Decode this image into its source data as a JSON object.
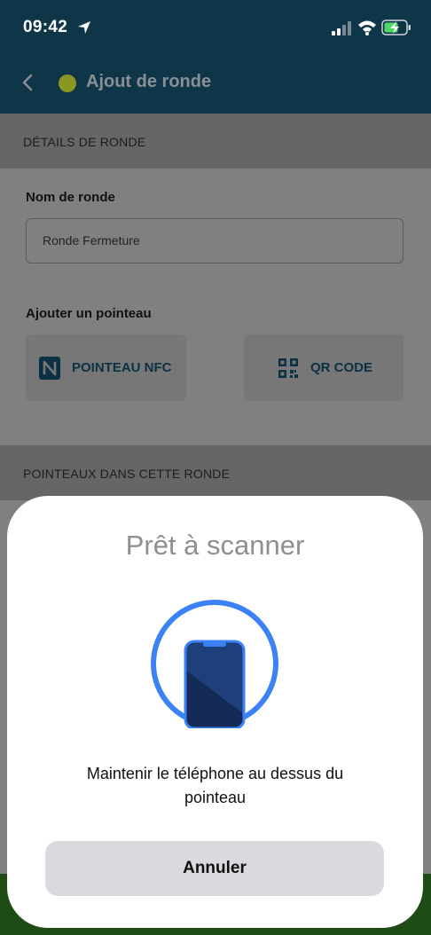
{
  "status_bar": {
    "time": "09:42"
  },
  "header": {
    "title": "Ajout de ronde",
    "status_dot_color": "#8a9622"
  },
  "details_section": {
    "heading": "DÉTAILS DE RONDE",
    "name_label": "Nom de ronde",
    "name_value": "Ronde Fermeture",
    "add_tag_label": "Ajouter un pointeau",
    "nfc_button": "POINTEAU NFC",
    "qr_button": "QR CODE"
  },
  "tags_section": {
    "heading": "POINTEAUX DANS CETTE RONDE"
  },
  "scan_sheet": {
    "title": "Prêt à scanner",
    "message": "Maintenir le téléphone au dessus du pointeau",
    "cancel_button": "Annuler",
    "accent_color": "#3b82f6"
  },
  "colors": {
    "header_bg": "#0f3548",
    "brand_text": "#0b3144"
  }
}
